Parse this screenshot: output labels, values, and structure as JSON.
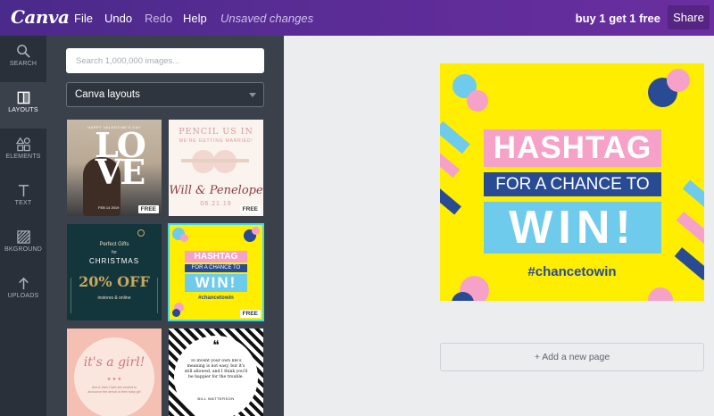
{
  "app": {
    "logo": "Canva",
    "menu": {
      "file": "File",
      "undo": "Undo",
      "redo": "Redo",
      "help": "Help"
    },
    "status": "Unsaved changes",
    "promo": "buy 1 get 1 free",
    "share": "Share"
  },
  "rail": [
    {
      "label": "SEARCH",
      "icon": "search-icon"
    },
    {
      "label": "LAYOUTS",
      "icon": "layouts-icon",
      "active": true
    },
    {
      "label": "ELEMENTS",
      "icon": "elements-icon"
    },
    {
      "label": "TEXT",
      "icon": "text-icon"
    },
    {
      "label": "BKGROUND",
      "icon": "background-icon"
    },
    {
      "label": "UPLOADS",
      "icon": "uploads-icon"
    }
  ],
  "panel": {
    "search_placeholder": "Search 1,000,000 images...",
    "dropdown_value": "Canva layouts",
    "free_badge": "FREE",
    "thumbs": {
      "love": {
        "top": "HAPPY VALENTINE'S DAY",
        "word": "LOVE",
        "sub": "FEB 14 2019"
      },
      "wedding": {
        "line1": "PENCIL US IN",
        "line2": "WE'RE GETTING MARRIED!",
        "names": "Will & Penelope",
        "date": "06.21.19"
      },
      "christmas": {
        "line1": "Perfect Gifts",
        "line2": "for",
        "line3": "CHRISTMAS",
        "offer": "20% OFF",
        "line4": "instores & online"
      },
      "hashtag": {
        "l1": "HASHTAG",
        "l2": "FOR A CHANCE TO",
        "l3": "WIN!",
        "tag": "#chancetowin"
      },
      "girl": {
        "title": "it's a girl!",
        "stars": "★ ★ ★",
        "small": "Ava & Jake Clark are excited to announce the arrival of their baby girl"
      },
      "quote": {
        "mark": "❝",
        "text": "To invent your own life's meaning is not easy, but it's still allowed, and I think you'll be happier for the trouble.",
        "author": "BILL WATTERSON"
      }
    }
  },
  "design": {
    "line1": "HASHTAG",
    "line2": "FOR A CHANCE TO",
    "line3": "WIN!",
    "hashtag": "#chancetowin",
    "colors": {
      "background": "#ffee00",
      "pink": "#f6a2c8",
      "blue": "#6fcbec",
      "navy": "#284b93"
    }
  },
  "add_page": "+ Add a new page"
}
